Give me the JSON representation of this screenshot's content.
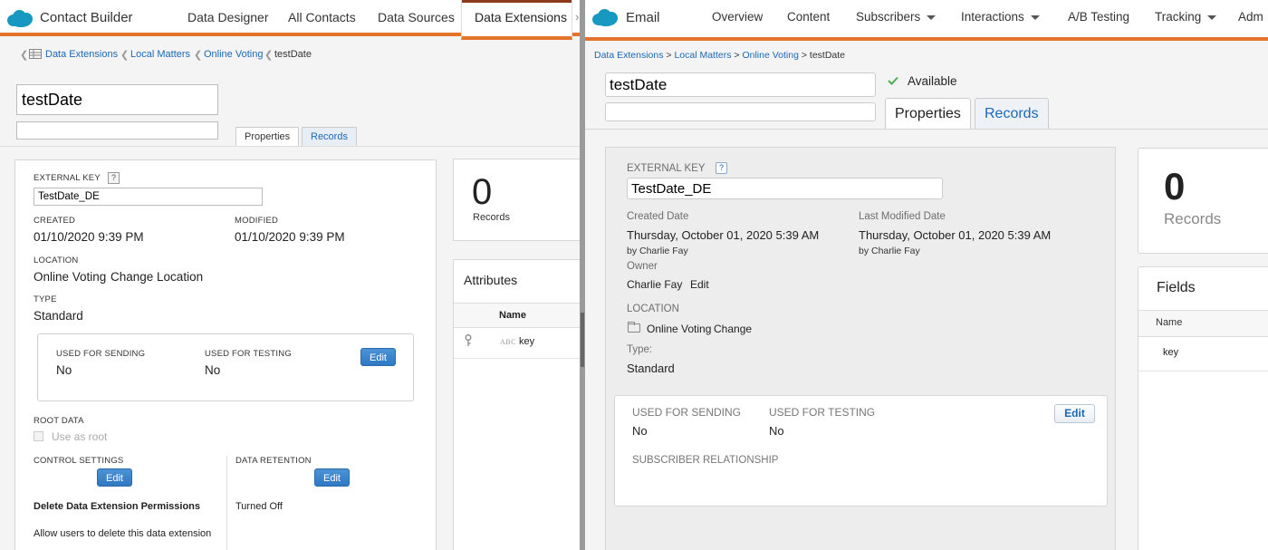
{
  "left": {
    "app_name": "Contact Builder",
    "nav": [
      "Data Designer",
      "All Contacts",
      "Data Sources",
      "Data Extensions"
    ],
    "nav_overflow": "›",
    "breadcrumb": [
      "Data Extensions",
      "Local Matters",
      "Online Voting",
      "testDate"
    ],
    "breadcrumb_sep": "❮",
    "name_value": "testDate",
    "tabs": [
      "Properties",
      "Records"
    ],
    "external_key_label": "EXTERNAL KEY",
    "help_glyph": "?",
    "external_key_value": "TestDate_DE",
    "created_label": "CREATED",
    "created_value": "01/10/2020 9:39 PM",
    "modified_label": "MODIFIED",
    "modified_value": "01/10/2020 9:39 PM",
    "location_label": "LOCATION",
    "location_value": "Online Voting",
    "change_location": "Change Location",
    "type_label": "TYPE",
    "type_value": "Standard",
    "used_for_sending_label": "USED FOR SENDING",
    "used_for_sending_value": "No",
    "used_for_testing_label": "USED FOR TESTING",
    "used_for_testing_value": "No",
    "edit": "Edit",
    "root_data_label": "ROOT DATA",
    "use_as_root": "Use as root",
    "control_settings_label": "CONTROL SETTINGS",
    "data_retention_label": "DATA RETENTION",
    "delete_permissions_title": "Delete Data Extension Permissions",
    "turned_off": "Turned Off",
    "allow_delete": "Allow users to delete this data extension",
    "records_count": "0",
    "records_label": "Records",
    "attributes_title": "Attributes",
    "attr_col_name": "Name",
    "attr_type_glyph": "ABC",
    "attr_key": "key"
  },
  "right": {
    "app_name": "Email",
    "nav": [
      "Overview",
      "Content",
      "Subscribers",
      "Interactions",
      "A/B Testing",
      "Tracking",
      "Adm"
    ],
    "breadcrumb": [
      "Data Extensions",
      "Local Matters",
      "Online Voting",
      "testDate"
    ],
    "breadcrumb_sep": ">",
    "name_value": "testDate",
    "available": "Available",
    "tabs": [
      "Properties",
      "Records"
    ],
    "external_key_label": "EXTERNAL KEY",
    "help_glyph": "?",
    "external_key_value": "TestDate_DE",
    "created_date_label": "Created Date",
    "created_date_value": "Thursday, October 01, 2020 5:39 AM",
    "created_by": "by Charlie Fay",
    "last_modified_label": "Last Modified Date",
    "last_modified_value": "Thursday, October 01, 2020 5:39 AM",
    "modified_by": "by Charlie Fay",
    "owner_label": "Owner",
    "owner_value": "Charlie Fay",
    "edit": "Edit",
    "location_label": "LOCATION",
    "location_value": "Online Voting",
    "change": "Change",
    "type_label": "Type:",
    "type_value": "Standard",
    "used_for_sending_label": "USED FOR SENDING",
    "used_for_sending_value": "No",
    "used_for_testing_label": "USED FOR TESTING",
    "used_for_testing_value": "No",
    "subscriber_relationship": "SUBSCRIBER RELATIONSHIP",
    "records_count": "0",
    "records_label": "Records",
    "fields_title": "Fields",
    "fields_col_name": "Name",
    "field_key": "key"
  },
  "colors": {
    "accent_orange": "#e2742b",
    "link_blue": "#1b68b7",
    "brand_cloud": "#1798c1"
  }
}
